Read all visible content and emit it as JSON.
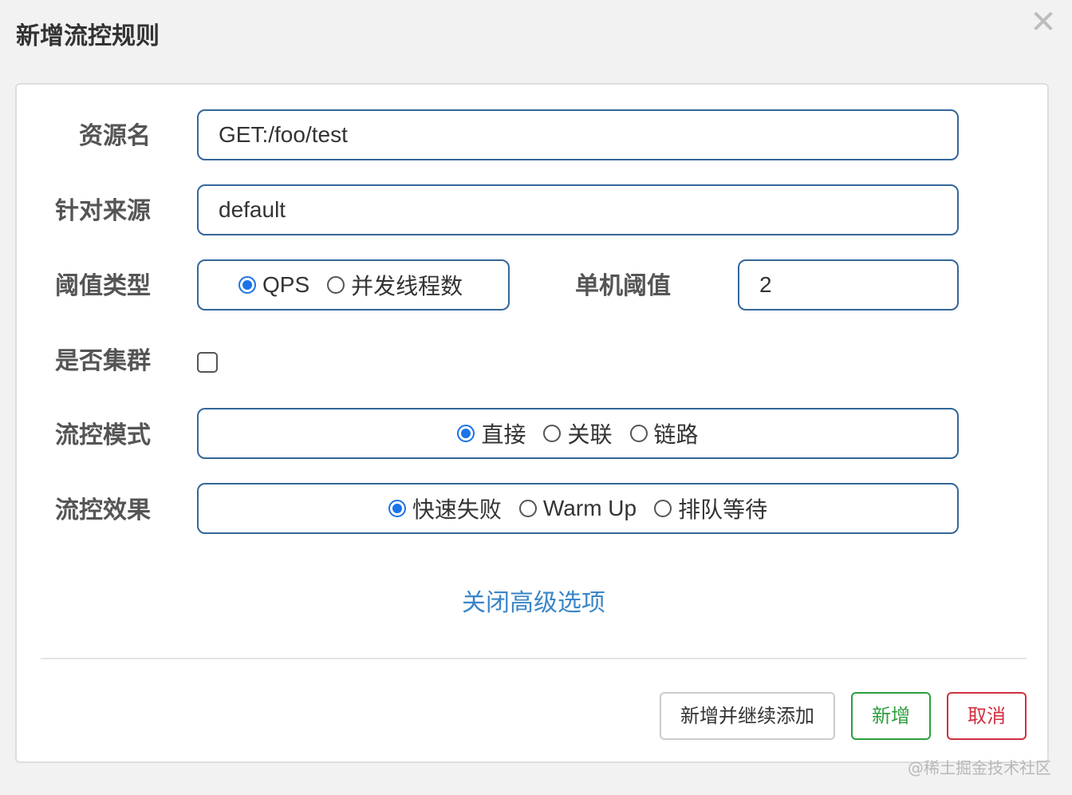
{
  "dialog": {
    "title": "新增流控规则",
    "close_glyph": "✕"
  },
  "form": {
    "resource_name": {
      "label": "资源名",
      "value": "GET:/foo/test"
    },
    "limit_app": {
      "label": "针对来源",
      "value": "default"
    },
    "threshold_type": {
      "label": "阈值类型",
      "options": [
        {
          "label": "QPS",
          "checked": true
        },
        {
          "label": "并发线程数",
          "checked": false
        }
      ]
    },
    "single_threshold": {
      "label": "单机阈值",
      "value": "2"
    },
    "cluster_mode": {
      "label": "是否集群",
      "checked": false
    },
    "strategy": {
      "label": "流控模式",
      "options": [
        {
          "label": "直接",
          "checked": true
        },
        {
          "label": "关联",
          "checked": false
        },
        {
          "label": "链路",
          "checked": false
        }
      ]
    },
    "control_behavior": {
      "label": "流控效果",
      "options": [
        {
          "label": "快速失败",
          "checked": true
        },
        {
          "label": "Warm Up",
          "checked": false
        },
        {
          "label": "排队等待",
          "checked": false
        }
      ]
    },
    "advanced_link": "关闭高级选项"
  },
  "footer": {
    "add_continue_label": "新增并继续添加",
    "add_label": "新增",
    "cancel_label": "取消"
  },
  "watermark": "@稀土掘金技术社区",
  "colors": {
    "accent": "#1a73e8",
    "border": "#34679a",
    "success": "#2e9e3e",
    "danger": "#d0303f",
    "link": "#3a86c8"
  }
}
